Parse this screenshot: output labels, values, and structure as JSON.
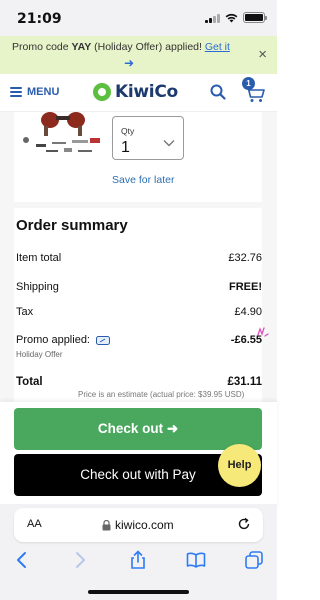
{
  "status_bar": {
    "time": "21:09"
  },
  "promo_banner": {
    "prefix": "Promo code",
    "code": "YAY",
    "suffix": "(Holiday Offer) applied!",
    "link": "Get it",
    "arrow": "➜",
    "close": "×"
  },
  "header": {
    "menu_label": "MENU",
    "logo_text": "KiwiCo",
    "cart_count": "1",
    "icons": [
      "hamburger-icon",
      "kiwico-logo",
      "search-icon",
      "cart-icon"
    ]
  },
  "product": {
    "qty_label": "Qty",
    "qty_value": "1",
    "save_for_later": "Save for later"
  },
  "summary": {
    "title": "Order summary",
    "rows": [
      {
        "label": "Item total",
        "value": "£32.76"
      },
      {
        "label": "Shipping",
        "value": "FREE!"
      },
      {
        "label": "Tax",
        "value": "£4.90"
      },
      {
        "label": "Promo applied:",
        "value": "-£6.55",
        "note": "Holiday Offer"
      }
    ],
    "total_label": "Total",
    "total_value": "£31.11",
    "estimate": "Price is an estimate (actual price: $39.95 USD)"
  },
  "checkout": {
    "checkout_label": "Check out ➜",
    "applepay_label": "Check out with  Pay",
    "help_label": "Help"
  },
  "browser": {
    "aa": "AA",
    "url": "kiwico.com"
  },
  "colors": {
    "accent_blue": "#2a5cad",
    "checkout_green": "#4aa85e",
    "promo_bg": "#e7f3c8",
    "help_yellow": "#f7e87a"
  }
}
